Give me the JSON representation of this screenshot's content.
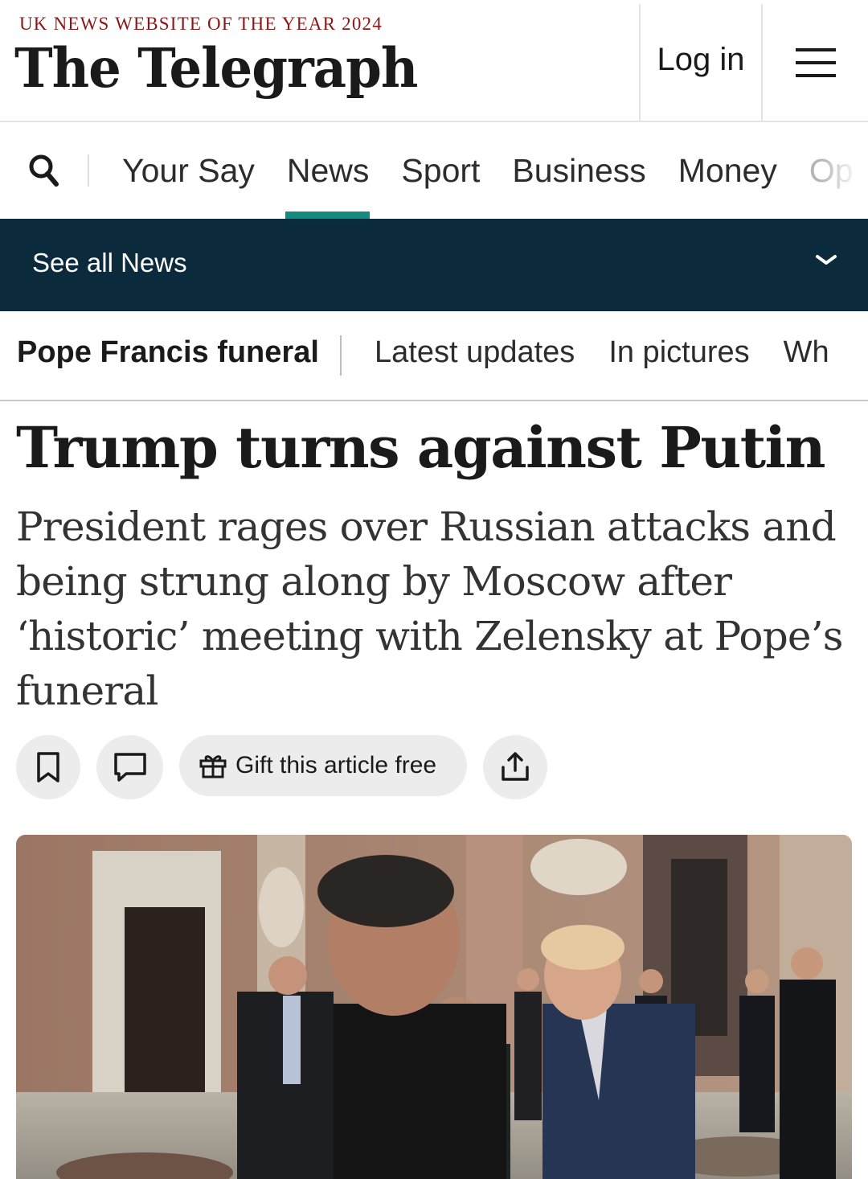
{
  "header": {
    "tagline": "UK NEWS WEBSITE OF THE YEAR 2024",
    "logo": "The Telegraph",
    "login_label": "Log in"
  },
  "nav": {
    "items": [
      {
        "label": "Your Say"
      },
      {
        "label": "News",
        "active": true
      },
      {
        "label": "Sport"
      },
      {
        "label": "Business"
      },
      {
        "label": "Money"
      },
      {
        "label": "Op"
      }
    ]
  },
  "section_bar": {
    "label": "See all News"
  },
  "topic_strip": {
    "title": "Pope Francis funeral",
    "links": [
      "Latest updates",
      "In pictures",
      "Wh"
    ]
  },
  "article": {
    "headline": "Trump turns against Putin",
    "standfirst": "President rages over Russian attacks and being strung along by Moscow after ‘historic’ meeting with Zelensky at Pope’s funeral",
    "gift_label": "Gift this article free"
  },
  "colors": {
    "accent_teal": "#138b80",
    "section_bar_bg": "#0b2a3c",
    "tagline_red": "#8c1515"
  },
  "icons": [
    "search-icon",
    "menu-icon",
    "chevron-down-icon",
    "bookmark-icon",
    "comment-icon",
    "gift-icon",
    "share-icon"
  ]
}
